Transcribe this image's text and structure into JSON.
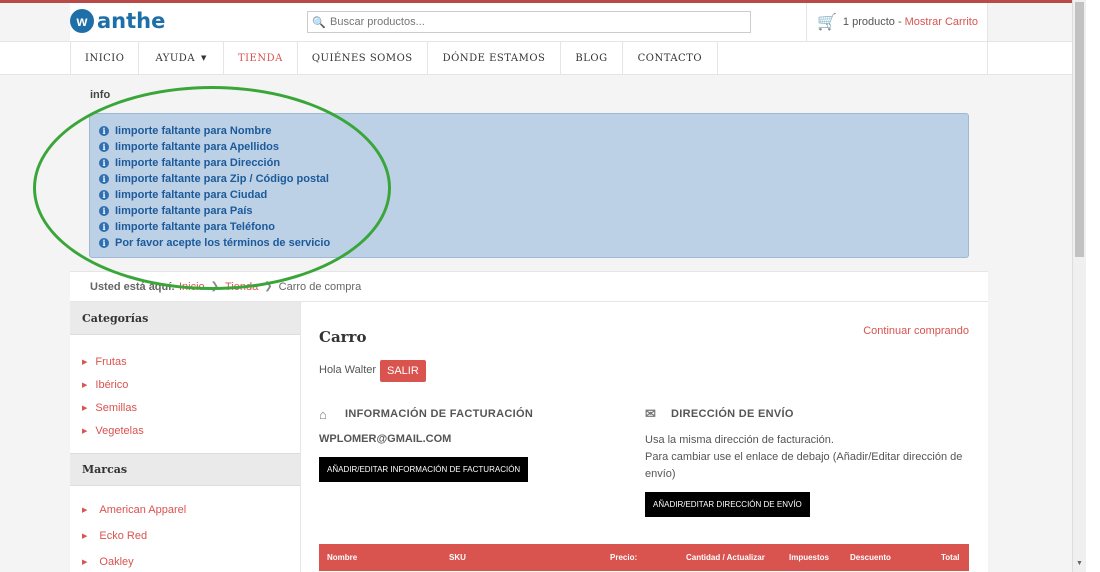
{
  "header": {
    "logo_text": "anthe",
    "search_placeholder": "Buscar productos...",
    "cart_count": "1 producto -",
    "cart_link": "Mostrar Carrito"
  },
  "nav": {
    "items": [
      "INICIO",
      "AYUDA",
      "TIENDA",
      "QUIÉNES SOMOS",
      "DÓNDE ESTAMOS",
      "BLOG",
      "CONTACTO"
    ],
    "active": "TIENDA"
  },
  "info": {
    "title": "info",
    "messages": [
      "Iimporte faltante para Nombre",
      "Iimporte faltante para Apellidos",
      "Iimporte faltante para Dirección",
      "Iimporte faltante para Zip / Código postal",
      "Iimporte faltante para Ciudad",
      "Iimporte faltante para País",
      "Iimporte faltante para Teléfono",
      "Por favor acepte los términos de servicio"
    ]
  },
  "breadcrumb": {
    "label": "Usted está aquí:",
    "items": [
      "Inicio",
      "Tienda"
    ],
    "current": "Carro de compra"
  },
  "sidebar": {
    "categories_title": "Categorías",
    "categories": [
      "Frutas",
      "Ibérico",
      "Semillas",
      "Vegetelas"
    ],
    "brands_title": "Marcas",
    "brands": [
      "American Apparel",
      "Ecko Red",
      "Oakley"
    ]
  },
  "main": {
    "title": "Carro",
    "continue_link": "Continuar comprando",
    "greeting": "Hola Walter",
    "logout_label": "SALIR",
    "billing_title": "INFORMACIÓN DE FACTURACIÓN",
    "billing_email": "WPLOMER@GMAIL.COM",
    "billing_button": "AÑADIR/EDITAR INFORMACIÓN DE FACTURACIÓN",
    "shipping_title": "DIRECCIÓN DE ENVÍO",
    "shipping_line1": "Usa la misma dirección de facturación.",
    "shipping_line2": "Para cambiar use el enlace de debajo (Añadir/Editar dirección de envío)",
    "shipping_button": "AÑADIR/EDITAR DIRECCIÓN DE ENVÍO",
    "table_headers": [
      "Nombre",
      "SKU",
      "Precio:",
      "Cantidad / Actualizar",
      "Impuestos",
      "Descuento",
      "Total"
    ]
  },
  "colors": {
    "accent": "#d9534f",
    "brand": "#1e6fa8",
    "alert_bg": "#bcd0e6",
    "annotation": "#3aa63a"
  }
}
